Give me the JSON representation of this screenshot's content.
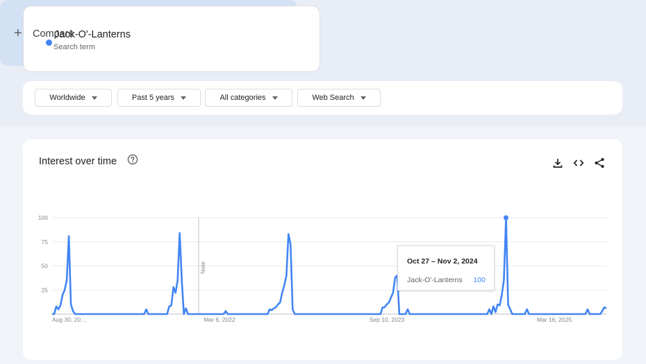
{
  "search_term": {
    "name": "Jack-O'-Lanterns",
    "subtitle": "Search term",
    "color": "#4285f4"
  },
  "compare": {
    "icon": "plus-icon",
    "plus": "+",
    "label": "Compare"
  },
  "filters": [
    {
      "label": "Worldwide"
    },
    {
      "label": "Past 5 years"
    },
    {
      "label": "All categories"
    },
    {
      "label": "Web Search"
    }
  ],
  "chart": {
    "title": "Interest over time",
    "icons": [
      "help-icon",
      "download-icon",
      "embed-icon",
      "share-icon"
    ],
    "note_label": "Note",
    "tooltip": {
      "date": "Oct 27 – Nov 2, 2024",
      "series": "Jack-O'-Lanterns",
      "value": "100"
    }
  },
  "chart_data": {
    "type": "line",
    "series": [
      {
        "name": "Jack-O'-Lanterns",
        "color": "#4285f4"
      }
    ],
    "yticks": [
      100,
      75,
      50,
      25
    ],
    "ylim": [
      0,
      100
    ],
    "xlabels": [
      "Aug 30, 20…",
      "Mar 6, 2022",
      "Sep 10, 2023",
      "Mar 16, 2025"
    ],
    "grid": true,
    "points": [
      [
        "2020-08-30",
        0
      ],
      [
        "2020-09-06",
        0
      ],
      [
        "2020-09-13",
        8
      ],
      [
        "2020-09-20",
        5
      ],
      [
        "2020-09-27",
        9
      ],
      [
        "2020-10-04",
        20
      ],
      [
        "2020-10-11",
        25
      ],
      [
        "2020-10-18",
        35
      ],
      [
        "2020-10-25",
        81
      ],
      [
        "2020-11-01",
        10
      ],
      [
        "2020-11-08",
        3
      ],
      [
        "2020-11-15",
        0
      ],
      [
        "2021-07-04",
        0
      ],
      [
        "2021-07-11",
        5
      ],
      [
        "2021-07-18",
        0
      ],
      [
        "2021-09-19",
        0
      ],
      [
        "2021-09-26",
        8
      ],
      [
        "2021-10-03",
        9
      ],
      [
        "2021-10-10",
        28
      ],
      [
        "2021-10-17",
        22
      ],
      [
        "2021-10-24",
        35
      ],
      [
        "2021-10-31",
        84
      ],
      [
        "2021-11-07",
        35
      ],
      [
        "2021-11-14",
        0
      ],
      [
        "2021-11-21",
        6
      ],
      [
        "2021-11-28",
        0
      ],
      [
        "2022-03-27",
        0
      ],
      [
        "2022-04-03",
        3
      ],
      [
        "2022-04-10",
        0
      ],
      [
        "2022-08-21",
        0
      ],
      [
        "2022-08-28",
        5
      ],
      [
        "2022-09-04",
        4
      ],
      [
        "2022-09-11",
        6
      ],
      [
        "2022-09-18",
        7
      ],
      [
        "2022-09-25",
        10
      ],
      [
        "2022-10-02",
        12
      ],
      [
        "2022-10-09",
        22
      ],
      [
        "2022-10-16",
        30
      ],
      [
        "2022-10-23",
        40
      ],
      [
        "2022-10-30",
        83
      ],
      [
        "2022-11-06",
        72
      ],
      [
        "2022-11-13",
        5
      ],
      [
        "2022-11-20",
        0
      ],
      [
        "2023-09-03",
        0
      ],
      [
        "2023-09-10",
        7
      ],
      [
        "2023-09-17",
        7
      ],
      [
        "2023-09-24",
        10
      ],
      [
        "2023-10-01",
        12
      ],
      [
        "2023-10-08",
        17
      ],
      [
        "2023-10-15",
        22
      ],
      [
        "2023-10-22",
        38
      ],
      [
        "2023-10-29",
        40
      ],
      [
        "2023-11-05",
        0
      ],
      [
        "2023-11-12",
        0
      ],
      [
        "2023-11-26",
        0
      ],
      [
        "2023-12-03",
        5
      ],
      [
        "2023-12-10",
        0
      ],
      [
        "2024-08-25",
        0
      ],
      [
        "2024-09-01",
        5
      ],
      [
        "2024-09-08",
        0
      ],
      [
        "2024-09-15",
        8
      ],
      [
        "2024-09-22",
        2
      ],
      [
        "2024-09-29",
        10
      ],
      [
        "2024-10-06",
        9
      ],
      [
        "2024-10-13",
        20
      ],
      [
        "2024-10-20",
        35
      ],
      [
        "2024-10-27",
        100
      ],
      [
        "2024-11-03",
        10
      ],
      [
        "2024-11-10",
        5
      ],
      [
        "2024-11-17",
        0
      ],
      [
        "2024-12-29",
        0
      ],
      [
        "2025-01-05",
        5
      ],
      [
        "2025-01-12",
        0
      ],
      [
        "2025-07-20",
        0
      ],
      [
        "2025-07-27",
        5
      ],
      [
        "2025-08-03",
        0
      ],
      [
        "2025-09-07",
        0
      ],
      [
        "2025-09-14",
        3
      ],
      [
        "2025-09-21",
        7
      ],
      [
        "2025-09-28",
        6
      ]
    ],
    "highlight": "2024-10-27"
  }
}
